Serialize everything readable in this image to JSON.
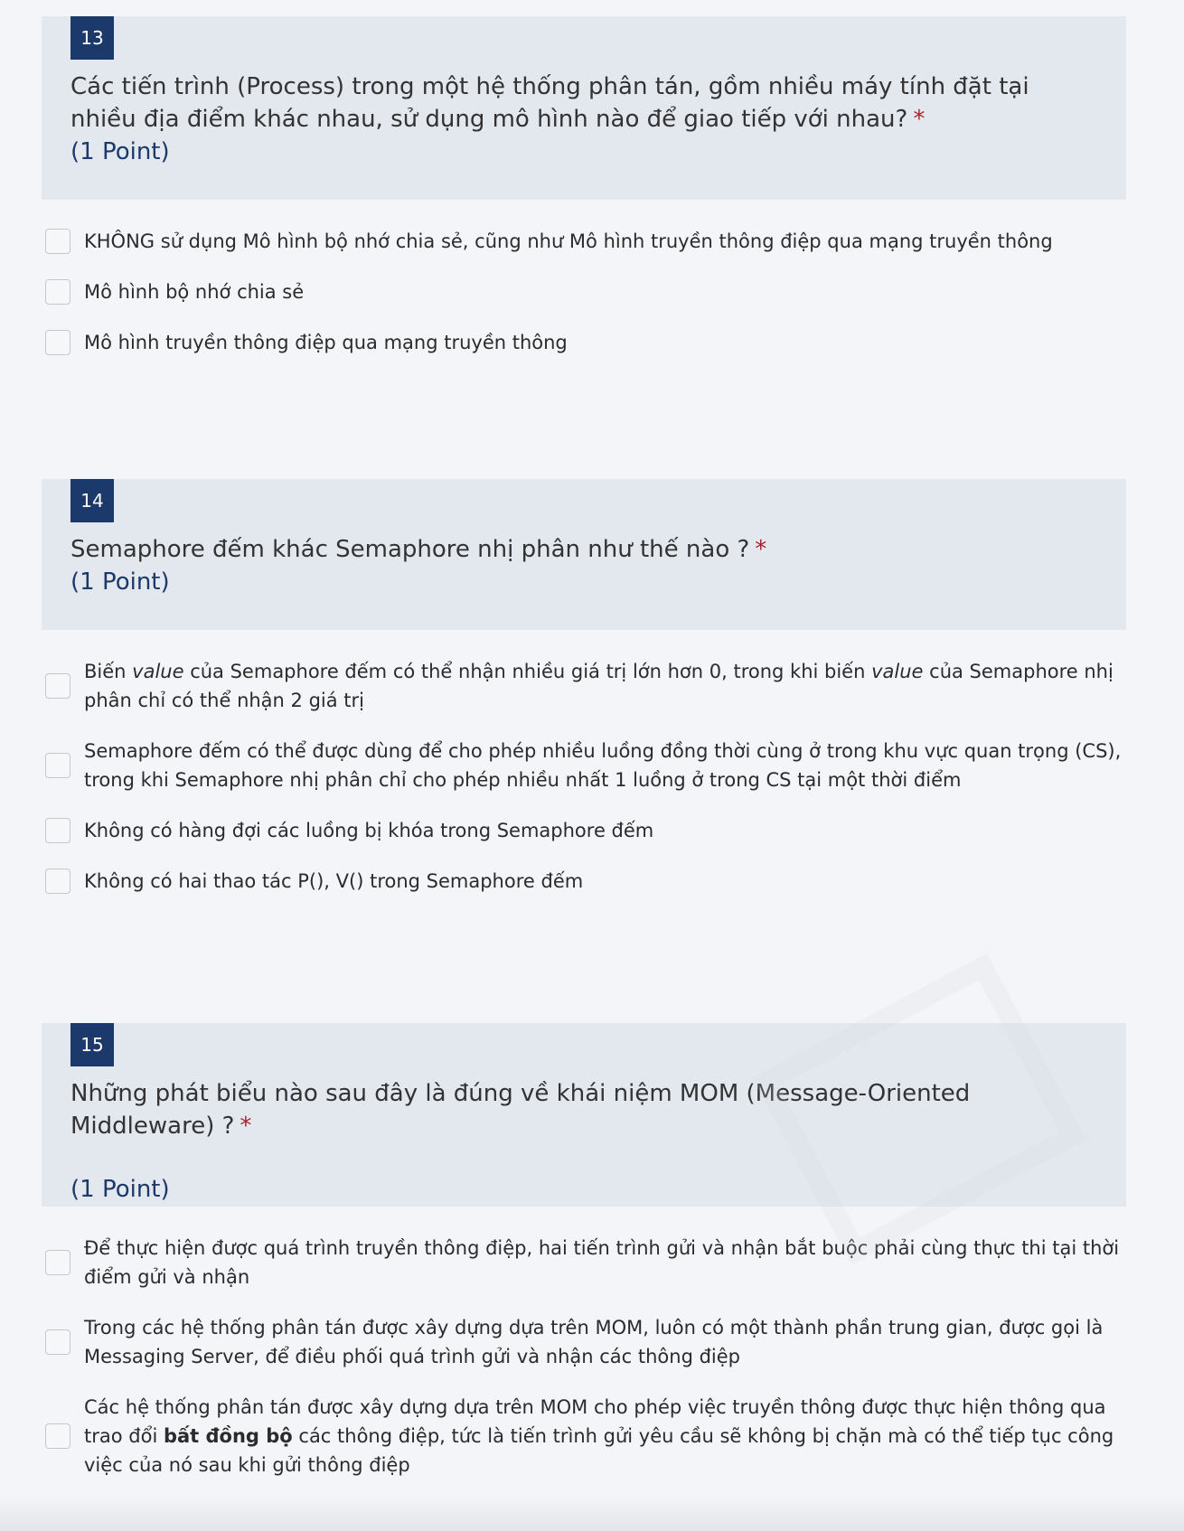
{
  "questions": [
    {
      "number": "13",
      "title": "Các tiến trình (Process) trong một hệ thống phân tán, gồm nhiều máy tính đặt tại nhiều địa điểm khác nhau, sử dụng mô hình nào để giao tiếp với nhau?",
      "required_mark": "*",
      "points": "(1 Point)",
      "options": [
        {
          "text": "KHÔNG sử dụng Mô hình bộ nhớ chia sẻ, cũng như Mô hình truyền thông điệp qua mạng truyền thông",
          "checked": false
        },
        {
          "text": "Mô hình bộ nhớ chia sẻ",
          "checked": false
        },
        {
          "text": "Mô hình truyền thông điệp qua mạng truyền thông",
          "checked": false
        }
      ]
    },
    {
      "number": "14",
      "title": "Semaphore đếm khác Semaphore nhị phân như thế nào ?",
      "required_mark": "*",
      "points": "(1 Point)",
      "options": [
        {
          "text_parts": [
            "Biến ",
            "value",
            " của Semaphore đếm có thể nhận nhiều giá trị lớn hơn 0, trong khi biến ",
            "value",
            " của Semaphore nhị phân chỉ có thể nhận 2 giá trị"
          ],
          "checked": false
        },
        {
          "text": "Semaphore đếm có thể được dùng để cho phép nhiều luồng đồng thời cùng ở trong khu vực quan trọng (CS), trong khi Semaphore nhị phân chỉ cho phép nhiều nhất 1 luồng ở trong CS tại một thời điểm",
          "checked": false
        },
        {
          "text": "Không có hàng đợi các luồng bị khóa trong Semaphore đếm",
          "checked": false
        },
        {
          "text": "Không có hai thao tác P(), V() trong Semaphore đếm",
          "checked": false
        }
      ]
    },
    {
      "number": "15",
      "title": "Những phát biểu nào sau đây là đúng về khái niệm MOM (Message-Oriented Middleware) ?",
      "required_mark": "*",
      "points": "(1 Point)",
      "options": [
        {
          "text": "Để thực hiện được quá trình truyền thông điệp, hai tiến trình gửi và nhận bắt buộc phải cùng thực thi tại thời điểm gửi và nhận",
          "checked": false
        },
        {
          "text": "Trong các hệ thống phân tán được xây dựng dựa trên MOM, luôn có một thành phần trung gian, được gọi là Messaging Server, để điều phối quá trình gửi và nhận các thông điệp",
          "checked": false
        },
        {
          "text_parts": [
            "Các hệ thống phân tán được xây dựng dựa trên MOM cho phép việc truyền thông được thực hiện thông qua trao đổi ",
            "bất đồng bộ",
            " các thông điệp, tức là tiến trình gửi yêu cầu sẽ không bị chặn mà có thể tiếp tục công việc của nó sau khi gửi thông điệp"
          ],
          "checked": false
        }
      ]
    }
  ]
}
